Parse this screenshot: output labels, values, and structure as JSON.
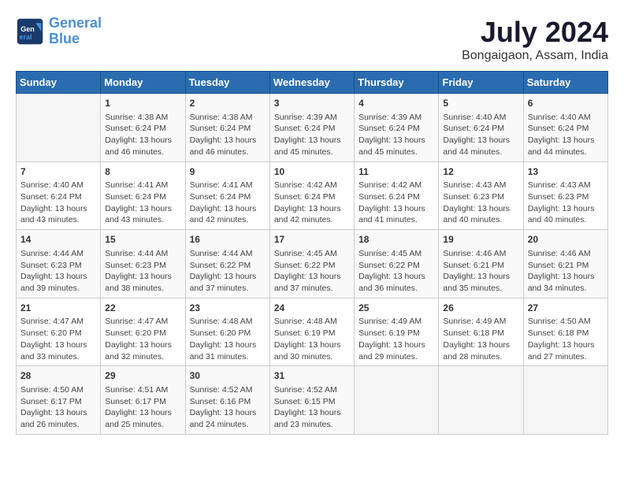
{
  "header": {
    "logo_line1": "General",
    "logo_line2": "Blue",
    "month_title": "July 2024",
    "location": "Bongaigaon, Assam, India"
  },
  "days_of_week": [
    "Sunday",
    "Monday",
    "Tuesday",
    "Wednesday",
    "Thursday",
    "Friday",
    "Saturday"
  ],
  "weeks": [
    [
      {
        "day": "",
        "content": ""
      },
      {
        "day": "1",
        "content": "Sunrise: 4:38 AM\nSunset: 6:24 PM\nDaylight: 13 hours\nand 46 minutes."
      },
      {
        "day": "2",
        "content": "Sunrise: 4:38 AM\nSunset: 6:24 PM\nDaylight: 13 hours\nand 46 minutes."
      },
      {
        "day": "3",
        "content": "Sunrise: 4:39 AM\nSunset: 6:24 PM\nDaylight: 13 hours\nand 45 minutes."
      },
      {
        "day": "4",
        "content": "Sunrise: 4:39 AM\nSunset: 6:24 PM\nDaylight: 13 hours\nand 45 minutes."
      },
      {
        "day": "5",
        "content": "Sunrise: 4:40 AM\nSunset: 6:24 PM\nDaylight: 13 hours\nand 44 minutes."
      },
      {
        "day": "6",
        "content": "Sunrise: 4:40 AM\nSunset: 6:24 PM\nDaylight: 13 hours\nand 44 minutes."
      }
    ],
    [
      {
        "day": "7",
        "content": "Sunrise: 4:40 AM\nSunset: 6:24 PM\nDaylight: 13 hours\nand 43 minutes."
      },
      {
        "day": "8",
        "content": "Sunrise: 4:41 AM\nSunset: 6:24 PM\nDaylight: 13 hours\nand 43 minutes."
      },
      {
        "day": "9",
        "content": "Sunrise: 4:41 AM\nSunset: 6:24 PM\nDaylight: 13 hours\nand 42 minutes."
      },
      {
        "day": "10",
        "content": "Sunrise: 4:42 AM\nSunset: 6:24 PM\nDaylight: 13 hours\nand 42 minutes."
      },
      {
        "day": "11",
        "content": "Sunrise: 4:42 AM\nSunset: 6:24 PM\nDaylight: 13 hours\nand 41 minutes."
      },
      {
        "day": "12",
        "content": "Sunrise: 4:43 AM\nSunset: 6:23 PM\nDaylight: 13 hours\nand 40 minutes."
      },
      {
        "day": "13",
        "content": "Sunrise: 4:43 AM\nSunset: 6:23 PM\nDaylight: 13 hours\nand 40 minutes."
      }
    ],
    [
      {
        "day": "14",
        "content": "Sunrise: 4:44 AM\nSunset: 6:23 PM\nDaylight: 13 hours\nand 39 minutes."
      },
      {
        "day": "15",
        "content": "Sunrise: 4:44 AM\nSunset: 6:23 PM\nDaylight: 13 hours\nand 38 minutes."
      },
      {
        "day": "16",
        "content": "Sunrise: 4:44 AM\nSunset: 6:22 PM\nDaylight: 13 hours\nand 37 minutes."
      },
      {
        "day": "17",
        "content": "Sunrise: 4:45 AM\nSunset: 6:22 PM\nDaylight: 13 hours\nand 37 minutes."
      },
      {
        "day": "18",
        "content": "Sunrise: 4:45 AM\nSunset: 6:22 PM\nDaylight: 13 hours\nand 36 minutes."
      },
      {
        "day": "19",
        "content": "Sunrise: 4:46 AM\nSunset: 6:21 PM\nDaylight: 13 hours\nand 35 minutes."
      },
      {
        "day": "20",
        "content": "Sunrise: 4:46 AM\nSunset: 6:21 PM\nDaylight: 13 hours\nand 34 minutes."
      }
    ],
    [
      {
        "day": "21",
        "content": "Sunrise: 4:47 AM\nSunset: 6:20 PM\nDaylight: 13 hours\nand 33 minutes."
      },
      {
        "day": "22",
        "content": "Sunrise: 4:47 AM\nSunset: 6:20 PM\nDaylight: 13 hours\nand 32 minutes."
      },
      {
        "day": "23",
        "content": "Sunrise: 4:48 AM\nSunset: 6:20 PM\nDaylight: 13 hours\nand 31 minutes."
      },
      {
        "day": "24",
        "content": "Sunrise: 4:48 AM\nSunset: 6:19 PM\nDaylight: 13 hours\nand 30 minutes."
      },
      {
        "day": "25",
        "content": "Sunrise: 4:49 AM\nSunset: 6:19 PM\nDaylight: 13 hours\nand 29 minutes."
      },
      {
        "day": "26",
        "content": "Sunrise: 4:49 AM\nSunset: 6:18 PM\nDaylight: 13 hours\nand 28 minutes."
      },
      {
        "day": "27",
        "content": "Sunrise: 4:50 AM\nSunset: 6:18 PM\nDaylight: 13 hours\nand 27 minutes."
      }
    ],
    [
      {
        "day": "28",
        "content": "Sunrise: 4:50 AM\nSunset: 6:17 PM\nDaylight: 13 hours\nand 26 minutes."
      },
      {
        "day": "29",
        "content": "Sunrise: 4:51 AM\nSunset: 6:17 PM\nDaylight: 13 hours\nand 25 minutes."
      },
      {
        "day": "30",
        "content": "Sunrise: 4:52 AM\nSunset: 6:16 PM\nDaylight: 13 hours\nand 24 minutes."
      },
      {
        "day": "31",
        "content": "Sunrise: 4:52 AM\nSunset: 6:15 PM\nDaylight: 13 hours\nand 23 minutes."
      },
      {
        "day": "",
        "content": ""
      },
      {
        "day": "",
        "content": ""
      },
      {
        "day": "",
        "content": ""
      }
    ]
  ]
}
